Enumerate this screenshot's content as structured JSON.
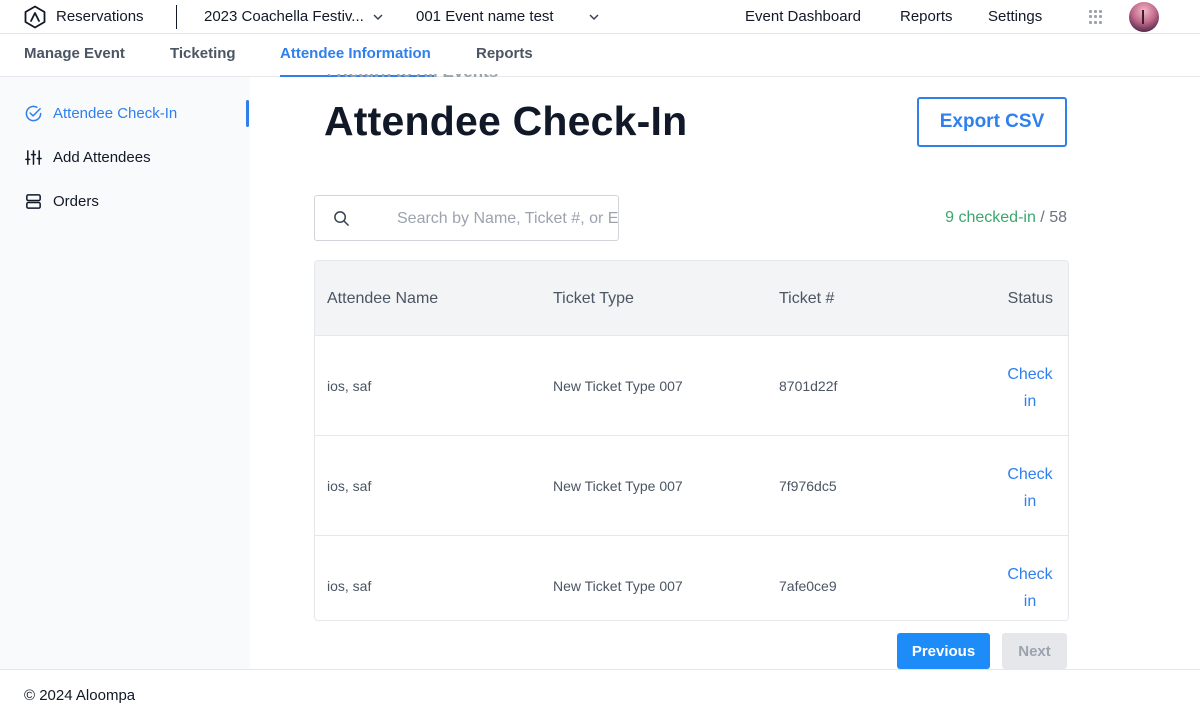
{
  "app": {
    "title": "Reservations"
  },
  "selectors": {
    "event": "2023 Coachella Festiv...",
    "event_name": "001 Event name test"
  },
  "top_nav": {
    "dashboard": "Event Dashboard",
    "reports": "Reports",
    "settings": "Settings"
  },
  "sub_nav": {
    "manage": "Manage Event",
    "ticketing": "Ticketing",
    "attendee": "Attendee Information",
    "reports": "Reports",
    "active": "Attendee Information"
  },
  "sidebar": {
    "items": [
      {
        "label": "Attendee Check-In",
        "icon": "check-circle-icon",
        "active": true
      },
      {
        "label": "Add Attendees",
        "icon": "sliders-icon",
        "active": false
      },
      {
        "label": "Orders",
        "icon": "server-icon",
        "active": false
      }
    ]
  },
  "main": {
    "back_link": "Return to All Events",
    "title": "Attendee Check-In",
    "export_label": "Export CSV",
    "search_placeholder": "Search by Name, Ticket #, or Email",
    "checked_in": "9 checked-in",
    "total": "58",
    "count_separator": " / "
  },
  "table": {
    "headers": [
      "Attendee Name",
      "Ticket Type",
      "Ticket #",
      "Status"
    ],
    "rows": [
      {
        "name": "ios, saf",
        "ticket_type": "New Ticket Type 007",
        "ticket_no": "8701d22f",
        "action_1": "Check",
        "action_2": "in"
      },
      {
        "name": "ios, saf",
        "ticket_type": "New Ticket Type 007",
        "ticket_no": "7f976dc5",
        "action_1": "Check",
        "action_2": "in"
      },
      {
        "name": "ios, saf",
        "ticket_type": "New Ticket Type 007",
        "ticket_no": "7afe0ce9",
        "action_1": "Check",
        "action_2": "in"
      }
    ]
  },
  "pagination": {
    "previous": "Previous",
    "next": "Next"
  },
  "footer": {
    "copyright": "© 2024 Aloompa"
  },
  "colors": {
    "accent": "#2f80ed",
    "checked_in": "#3aa76d",
    "primary_button": "#1d8cf8"
  }
}
